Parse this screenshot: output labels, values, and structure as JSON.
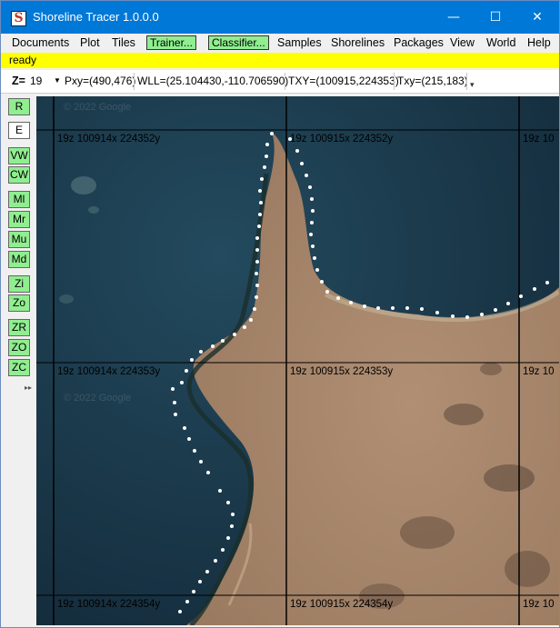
{
  "window": {
    "title": "Shoreline Tracer 1.0.0.0",
    "app_icon_letter": "S",
    "minimize_glyph": "—",
    "maximize_glyph": "☐",
    "close_glyph": "✕"
  },
  "menu": {
    "items": [
      "Documents",
      "Plot",
      "Tiles"
    ],
    "trainer_button": "Trainer...",
    "classifier_button": "Classifier...",
    "items_right": [
      "Samples",
      "Shorelines",
      "Packages",
      "View",
      "World",
      "Help"
    ],
    "button_color": "#90ee90"
  },
  "status": {
    "text": "ready",
    "background": "#ffff00"
  },
  "info": {
    "zoom_label": "Z=",
    "zoom_value": "19",
    "pxy": "Pxy=(490,476)",
    "wll": "WLL=(25.104430,-110.706590)",
    "txy_global": "TXY=(100915,224353)",
    "txy_local": "Txy=(215,183)"
  },
  "tools": [
    "R",
    "E",
    "VW",
    "CW",
    "Ml",
    "Mr",
    "Mu",
    "Md",
    "Zi",
    "Zo",
    "ZR",
    "ZO",
    "ZC"
  ],
  "tiles": {
    "labels": [
      [
        "19z 100914x 224352y",
        "19z 100915x 224352y",
        "19z 10"
      ],
      [
        "19z 100914x 224353y",
        "19z 100915x 224353y",
        "19z 10"
      ],
      [
        "19z 100914x 224354y",
        "19z 100915x 224354y",
        "19z 10"
      ]
    ],
    "watermark": "© 2022 Google"
  },
  "map_colors": {
    "water": "#193548",
    "sand": "#a5856a",
    "tile_line": "#000000",
    "shoreline_dots": "#ffffff"
  }
}
